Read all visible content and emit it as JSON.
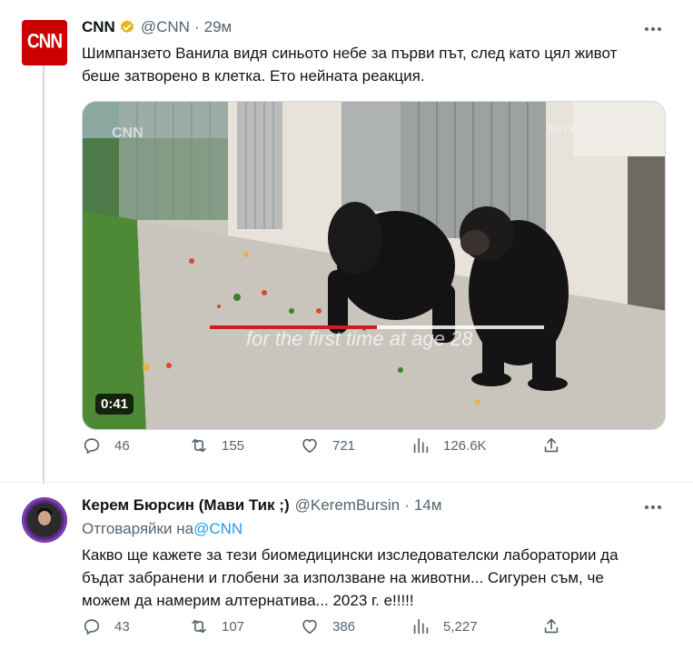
{
  "tweet1": {
    "avatar_text": "CNN",
    "name": "CNN",
    "handle": "@CNN",
    "separator": "·",
    "time": "29м",
    "text_line1": "Шимпанзето Ванила видя синьото небе за първи път, след като цял живот",
    "text_line2": "беше затворено в клетка. Ето нейната реакция.",
    "video": {
      "duration": "0:41",
      "watermark": "SAVE THE CHIMPS",
      "channel_mark": "CNN",
      "subtitle": "for the first time at age 28",
      "progress": 0.5
    },
    "stats": {
      "replies": "46",
      "retweets": "155",
      "likes": "721",
      "views": "126.6K"
    }
  },
  "tweet2": {
    "name": "Керем Бюрсин (Мави Тик ;)",
    "handle": "@KeremBursin",
    "separator": "·",
    "time": "14м",
    "reply_prefix": "Отговаряйки на",
    "reply_target": "@CNN",
    "text_line1": "Какво ще кажете за тези биомедицински изследователски лаборатории да",
    "text_line2": "бъдат забранени и глобени за използване на животни... Сигурен съм, че",
    "text_line3": "можем да намерим алтернатива... 2023 г. е!!!!!",
    "stats": {
      "replies": "43",
      "retweets": "107",
      "likes": "386",
      "views": "5,227"
    }
  },
  "colors": {
    "accent": "#1d9bf0",
    "verified_gold": "#e2b719",
    "cnn_red": "#cc0000",
    "muted": "#536471"
  }
}
